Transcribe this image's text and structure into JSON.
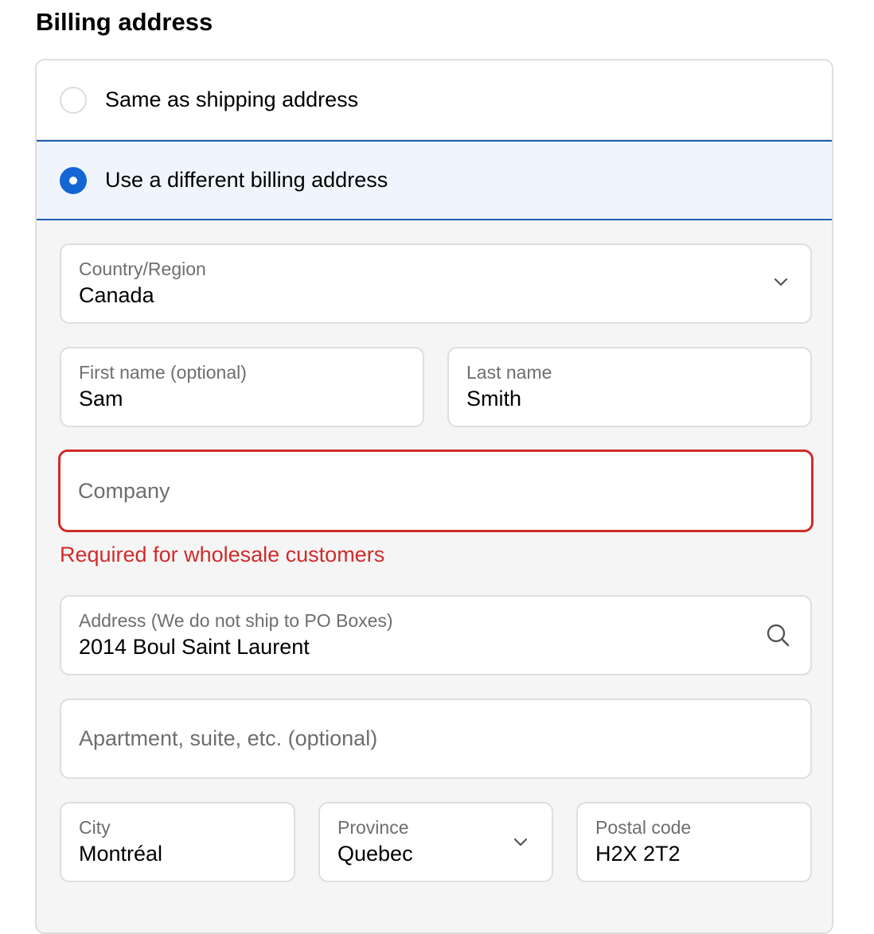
{
  "section_title": "Billing address",
  "billing_options": {
    "same": {
      "label": "Same as shipping address",
      "selected": false
    },
    "different": {
      "label": "Use a different billing address",
      "selected": true
    }
  },
  "country": {
    "label": "Country/Region",
    "value": "Canada",
    "icon": "chevron-down-icon"
  },
  "first_name": {
    "label": "First name (optional)",
    "value": "Sam"
  },
  "last_name": {
    "label": "Last name",
    "value": "Smith"
  },
  "company": {
    "placeholder": "Company",
    "error": "Required for wholesale customers"
  },
  "address": {
    "label": "Address (We do not ship to PO Boxes)",
    "value": "2014 Boul Saint Laurent",
    "icon": "search-icon"
  },
  "apartment": {
    "placeholder": "Apartment, suite, etc. (optional)"
  },
  "city": {
    "label": "City",
    "value": "Montréal"
  },
  "province": {
    "label": "Province",
    "value": "Quebec",
    "icon": "chevron-down-icon"
  },
  "postal_code": {
    "label": "Postal code",
    "value": "H2X 2T2"
  },
  "colors": {
    "accent": "#1466d4",
    "selected_bg": "#f0f5fd",
    "error": "#d02b2b",
    "panel_bg": "#f5f5f5"
  }
}
